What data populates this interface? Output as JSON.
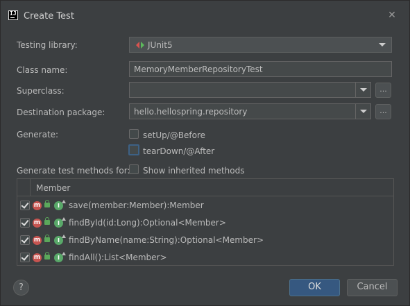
{
  "window": {
    "title": "Create Test"
  },
  "form": {
    "testing_library_label": "Testing library:",
    "testing_library_value": "JUnit5",
    "class_name_label": "Class name:",
    "class_name_value": "MemoryMemberRepositoryTest",
    "superclass_label": "Superclass:",
    "superclass_value": "",
    "browse_label": "...",
    "destination_label": "Destination package:",
    "destination_value": "hello.hellospring.repository",
    "generate_label": "Generate:",
    "setup_label": "setUp/@Before",
    "setup_checked": false,
    "teardown_label": "tearDown/@After",
    "teardown_checked": false,
    "methods_label": "Generate test methods for:",
    "inherited_label": "Show inherited methods",
    "inherited_checked": false
  },
  "table": {
    "header": "Member",
    "rows": [
      {
        "method": "save(member:Member):Member",
        "checked": true
      },
      {
        "method": "findById(id:Long):Optional<Member>",
        "checked": true
      },
      {
        "method": "findByName(name:String):Optional<Member>",
        "checked": true
      },
      {
        "method": "findAll():List<Member>",
        "checked": true
      }
    ]
  },
  "footer": {
    "help_label": "?",
    "ok_label": "OK",
    "cancel_label": "Cancel"
  },
  "colors": {
    "background": "#3c3f41",
    "field": "#45494a",
    "ok_button": "#365880",
    "method_icon": "#c75450",
    "override_icon": "#59a869"
  },
  "icons": {
    "app": "intellij-icon",
    "close": "close-icon",
    "junit": "junit-icon",
    "method": "method-icon",
    "lock": "lock-icon",
    "override": "override-icon"
  }
}
